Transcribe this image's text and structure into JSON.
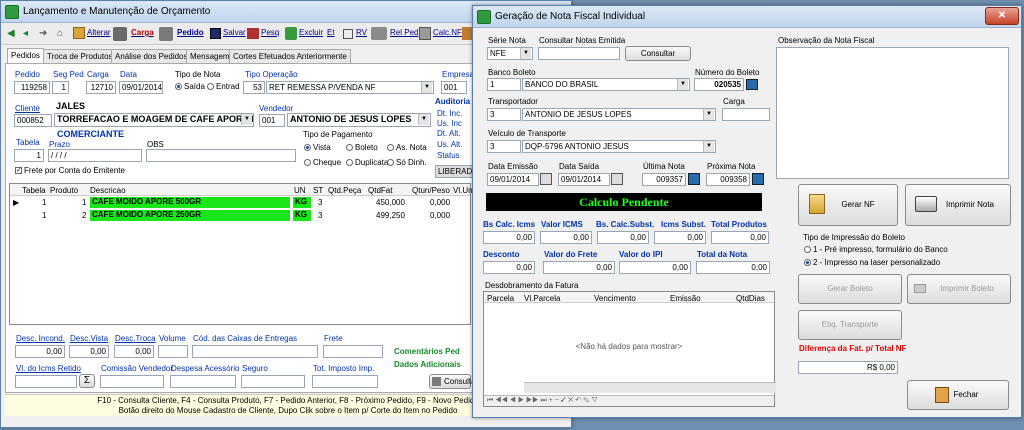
{
  "left_window": {
    "title": "Lançamento e Manutenção de Orçamento",
    "toolbar": {
      "alterar": "Alterar",
      "carga": "Carga",
      "pedido": "Pedido",
      "salvar": "Salvar",
      "pesq": "Pesq",
      "excluir": "Excluir",
      "et": "Et",
      "rv": "RV",
      "rel_ped": "Rel Ped",
      "calc_nf": "Calc.NF"
    },
    "tabs": [
      "Pedidos",
      "Troca de Produtos",
      "Análise dos Pedidos",
      "Mensagem",
      "Cortes Efetuados Anteriormente"
    ],
    "form": {
      "pedido_label": "Pedido",
      "pedido": "119258",
      "seg_ped_label": "Seg Ped",
      "seg_ped": "1",
      "carga_label": "Carga",
      "carga": "12710",
      "data_label": "Data",
      "data": "09/01/2014",
      "tipo_nota_label": "Tipo de Nota",
      "saida": "Saída",
      "entrada": "Entrad",
      "tipo_operacao_label": "Tipo Operação",
      "tipo_operacao_code": "53",
      "tipo_operacao": "RET REMESSA P/VENDA NF",
      "empresa_label": "Empresa",
      "empresa": "001",
      "cliente_label": "Cliente",
      "cliente_name_short": "JALES",
      "cliente_code": "000852",
      "cliente": "TORREFACAO E MOAGEM DE CAFE APORE L",
      "vendedor_label": "Vendedor",
      "vendedor_code": "001",
      "vendedor": "ANTONIO DE JESUS LOPES",
      "auditoria_label": "Auditoria",
      "dt_inc": "Dt. Inc.",
      "us_inc": "Us. Inc",
      "dt_alt1": "Dt. Alt.",
      "us_alt": "Us. Alt.",
      "status": "Status",
      "liberado": "LIBERADO",
      "comerciante": "COMERCIANTE",
      "tabela_label": "Tabela",
      "tabela": "1",
      "prazo_label": "Prazo",
      "prazo": "/ / / /",
      "obs_label": "OBS",
      "tipo_pagamento_label": "Tipo de Pagamento",
      "pag_vista": "Vista",
      "pag_boleto": "Boleto",
      "pag_as_nota": "As. Nota",
      "pag_cheque": "Cheque",
      "pag_duplicata": "Duplicata",
      "pag_so_dinh": "Só Dinh.",
      "frete_emitente": "Frete por Conta do Emitente"
    },
    "grid": {
      "headers": [
        "Tabela",
        "Produto",
        "Descricao",
        "UN",
        "ST",
        "Qtd.Peça",
        "QtdFat",
        "Qtun/Peso",
        "Vl.Uni"
      ],
      "rows": [
        {
          "tabela": "1",
          "produto": "1",
          "descricao": "CAFE MOIDO APORE 500GR",
          "un": "KG",
          "st": "3",
          "qtdfat": "450,000",
          "peso": "0,000"
        },
        {
          "tabela": "1",
          "produto": "2",
          "descricao": "CAFE MOIDO APORE 250GR",
          "un": "KG",
          "st": "3",
          "qtdfat": "499,250",
          "peso": "0,000"
        }
      ]
    },
    "bottom": {
      "desc_incond": "Desc. Incond.",
      "desc_vista": "Desc.Vista",
      "desc_troca": "Desc.Troca",
      "volume": "Volume",
      "cod_caixas": "Cód. das Caixas de Entregas",
      "frete": "Frete",
      "v_incond": "0,00",
      "v_vista": "0,00",
      "v_troca": "0,00",
      "comentarios": "Comentários Ped",
      "dados_adicionais": "Dados Adicionais",
      "vl_icms": "Vl. do Icms Retido",
      "comissao": "Comissão Vendedor",
      "despesa": "Despesa Acessório",
      "seguro": "Seguro",
      "tot_imposto": "Tot. Imposto Imp.",
      "sigma": "Σ",
      "consulta": "Consulta",
      "help_line1": "F10 - Consulta Cliente,   F4 - Consulta Produto,   F7 - Pedido Anterior,   F8 - Próximo Pedido,   F9 - Novo Pedido",
      "help_line2": "Botão direito do Mouse Cadastro de Cliente,  Dupo Clik sobre o Item p/ Corte do Item no Pedido"
    }
  },
  "right_window": {
    "title": "Geração de Nota Fiscal Individual",
    "serie_nota_label": "Série Nota",
    "serie_nota": "NFE",
    "consultar_notas_label": "Consultar Notas Emitida",
    "consultar_btn": "Consultar",
    "observacao_label": "Observação da Nota Fiscal",
    "banco_boleto_label": "Banco Boleto",
    "banco_code": "1",
    "banco": "BANCO DO BRASIL",
    "numero_boleto_label": "Número do Boleto",
    "numero_boleto": "020535",
    "transportador_label": "Transportador",
    "transportador_code": "3",
    "transportador": "ANTONIO DE JESUS LOPES",
    "carga_label": "Carga",
    "veiculo_label": "Veículo de Transporte",
    "veiculo_code": "3",
    "veiculo": "DQP-5796 ANTONIO JESUS",
    "data_emissao_label": "Data Emissão",
    "data_emissao": "09/01/2014",
    "data_saida_label": "Data Saída",
    "data_saida": "09/01/2014",
    "ultima_nota_label": "Última Nota",
    "ultima_nota": "009357",
    "proxima_nota_label": "Próxima Nota",
    "proxima_nota": "009358",
    "calculo_pendente": "Calculo Pendente",
    "totals": {
      "bs_calc_icms": "Bs Calc. Icms",
      "valor_icms": "Valor ICMS",
      "bs_calc_subst": "Bs. Calc.Subst.",
      "icms_subst": "Icms Subst.",
      "total_produtos": "Total Produtos",
      "v1": "0,00",
      "v2": "0,00",
      "v3": "0,00",
      "v4": "0,00",
      "v5": "0,00",
      "desconto": "Desconto",
      "valor_frete": "Valor do Frete",
      "valor_ipi": "Valor do IPI",
      "total_nota": "Total da Nota",
      "v6": "0,00",
      "v7": "0,00",
      "v8": "0,00",
      "v9": "0,00"
    },
    "gerar_nf": "Gerar NF",
    "imprimir_nota": "Imprimir Nota",
    "tipo_impressao_label": "Tipo de Impressão do Boleto",
    "tipo_imp_1": "1 - Pré impresso, formulário do Banco",
    "tipo_imp_2": "2 - Impresso na laser personalizado",
    "gerar_boleto": "Gerar Boleto",
    "imprimir_boleto": "Imprimir Boleto",
    "etiq_transporte": "Etiq. Transporte",
    "diferenca_label": "Diferença da Fat. p/ Total NF",
    "diferenca_valor": "R$ 0,00",
    "fechar": "Fechar",
    "desdobramento_label": "Desdobramento da Fatura",
    "fatura_headers": [
      "Parcela",
      "Vl.Parcela",
      "Vencimento",
      "Emissão",
      "QtdDias"
    ],
    "no_data": "<Não há dados para mostrar>"
  }
}
